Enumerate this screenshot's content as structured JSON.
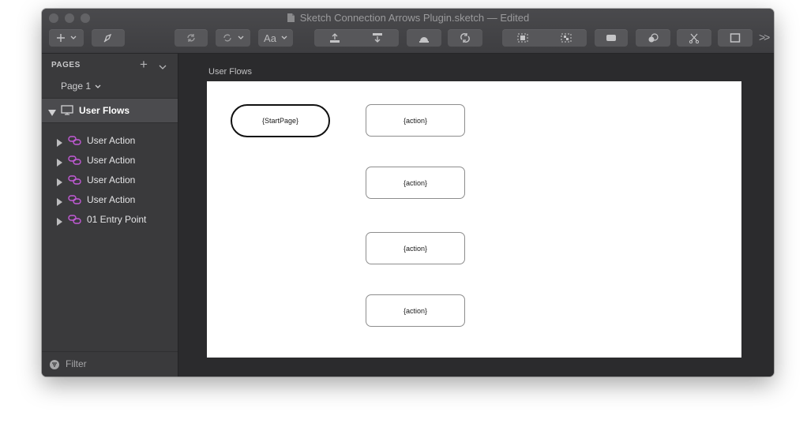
{
  "window": {
    "title": "Sketch Connection Arrows Plugin.sketch — Edited"
  },
  "toolbar": {
    "font_label": "Aa"
  },
  "sidebar": {
    "pages_header": "PAGES",
    "page_selector": "Page 1",
    "artboard_label": "User Flows",
    "layers": [
      {
        "label": "User Action"
      },
      {
        "label": "User Action"
      },
      {
        "label": "User Action"
      },
      {
        "label": "User Action"
      },
      {
        "label": "01 Entry Point"
      }
    ],
    "filter_label": "Filter"
  },
  "canvas": {
    "artboard_title": "User Flows",
    "start_node": "{StartPage}",
    "action_nodes": [
      "{action}",
      "{action}",
      "{action}",
      "{action}"
    ]
  },
  "colors": {
    "link_icon": "#c25ad6",
    "sidebar_bg": "#3a3a3c",
    "canvas_bg": "#2b2b2d",
    "selected_row": "#4b4b4e"
  }
}
